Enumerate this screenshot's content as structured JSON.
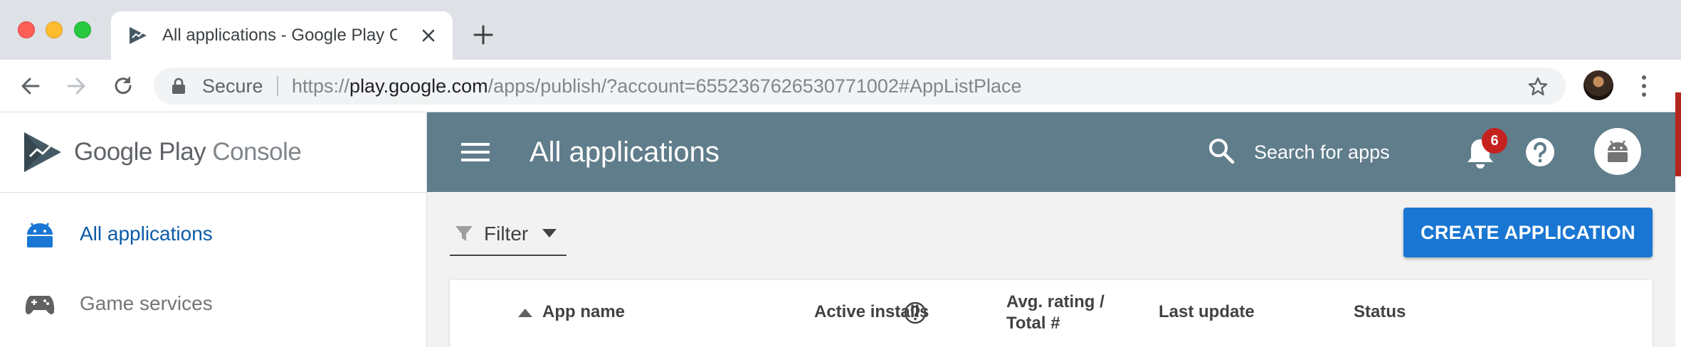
{
  "browser": {
    "tab_title": "All applications - Google Play Console",
    "address": {
      "secure_label": "Secure",
      "url_prefix": "https://",
      "url_domain": "play.google.com",
      "url_path": "/apps/publish/?account=6552367626530771002#AppListPlace"
    }
  },
  "sidebar": {
    "logo": {
      "brand": "Google Play",
      "product": "Console"
    },
    "items": [
      {
        "label": "All applications",
        "icon": "android-icon",
        "active": true
      },
      {
        "label": "Game services",
        "icon": "gamepad-icon",
        "active": false
      }
    ]
  },
  "header": {
    "title": "All applications",
    "search_placeholder": "Search for apps",
    "notification_count": "6"
  },
  "content": {
    "filter_label": "Filter",
    "create_button": "CREATE APPLICATION",
    "table": {
      "columns": [
        {
          "label": "App name"
        },
        {
          "label": "Active installs"
        },
        {
          "label": "Avg. rating /"
        },
        {
          "label": "Total #"
        },
        {
          "label": "Last update"
        },
        {
          "label": "Status"
        }
      ]
    }
  },
  "colors": {
    "header_bg": "#607d8b",
    "accent": "#1976d2",
    "active_nav": "#0b5ba8",
    "badge": "#c5221f"
  }
}
